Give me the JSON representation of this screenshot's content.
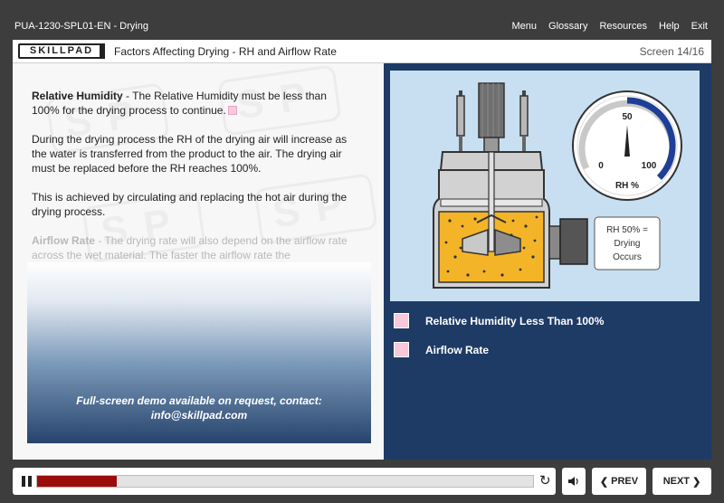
{
  "header": {
    "course_id": "PUA-1230-SPL01-EN - Drying",
    "nav": [
      "Menu",
      "Glossary",
      "Resources",
      "Help",
      "Exit"
    ]
  },
  "title_bar": {
    "logo": "SKILLPAD",
    "title": "Factors Affecting Drying - RH and Airflow Rate",
    "screen_counter": "Screen 14/16"
  },
  "body_text": {
    "p1_heading": "Relative Humidity",
    "p1_text": " - The Relative Humidity must be less than 100% for the drying process to continue.",
    "p2": "During the drying process the RH of the drying air will increase as the water is transferred from the product to the air. The drying air must be replaced before the RH reaches 100%.",
    "p3": "This is achieved by circulating and replacing the hot air during the drying process.",
    "p4_heading": "Airflow Rate",
    "p4_text": " - The drying rate will also depend on the airflow rate across the wet material. The faster the airflow rate the"
  },
  "demo": {
    "line1": "Full-screen demo available on request, contact:",
    "line2": "info@skillpad.com"
  },
  "watermark_text": "SP",
  "illustration": {
    "gauge_label": "RH %",
    "gauge_min": "0",
    "gauge_mid": "50",
    "gauge_max": "100",
    "gauge_value_percent": 50,
    "callout_line1": "RH 50% =",
    "callout_line2": "Drying",
    "callout_line3": "Occurs"
  },
  "legend": [
    {
      "label": "Relative Humidity Less Than 100%"
    },
    {
      "label": "Airflow Rate"
    }
  ],
  "player": {
    "progress_percent": 16,
    "prev_label": "PREV",
    "next_label": "NEXT"
  },
  "colors": {
    "accent_dark_blue": "#1e3b66",
    "progress_red": "#9b0d0d",
    "swatch_pink": "#f7c8de",
    "product_yellow": "#f3b428"
  }
}
